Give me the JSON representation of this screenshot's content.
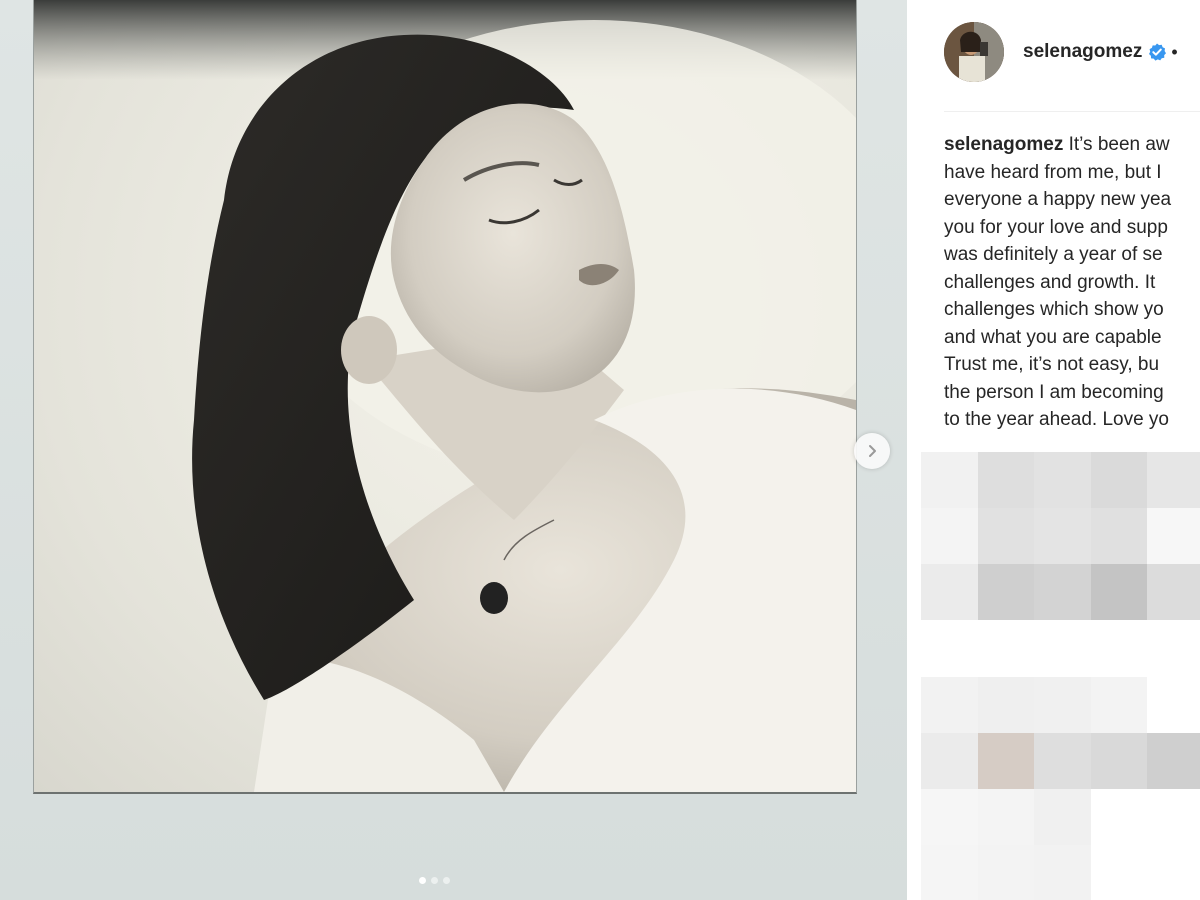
{
  "post": {
    "username": "selenagomez",
    "header_separator": "•",
    "verified": true,
    "caption_lines": [
      "It’s been aw",
      "have heard from me, but I",
      "everyone a happy new yea",
      "you for your love and supp",
      "was definitely a year of se",
      "challenges and growth. It",
      "challenges which show yo",
      "and what you are capable",
      "Trust me, it’s not easy, bu",
      "the person I am becoming",
      "to the year ahead. Love yo"
    ]
  },
  "carousel": {
    "slide_count": 3,
    "active_index": 0
  },
  "icons": {
    "next": "chevron-right-icon",
    "verified": "verified-badge-icon",
    "avatar": "avatar"
  },
  "colors": {
    "verified_blue": "#3897f0",
    "text": "#262626",
    "frame": "#d9e0df"
  }
}
